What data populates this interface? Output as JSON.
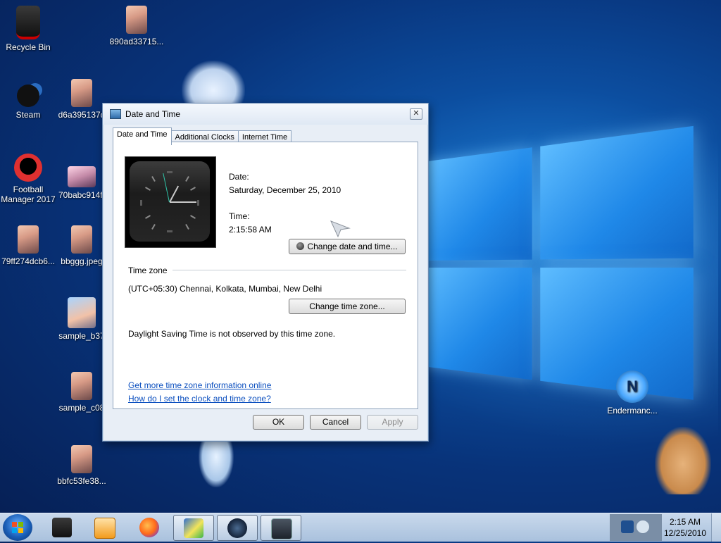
{
  "desktop_icons": [
    {
      "label": "Recycle Bin",
      "icon": "recycle-bin-icon"
    },
    {
      "label": "890ad33715...",
      "icon": "image-file-icon"
    },
    {
      "label": "Steam",
      "icon": "steam-icon"
    },
    {
      "label": "d6a395137d",
      "icon": "image-file-icon"
    },
    {
      "label": "Football Manager 2017",
      "icon": "football-manager-icon"
    },
    {
      "label": "70babc914f.",
      "icon": "image-file-icon"
    },
    {
      "label": "79ff274dcb6...",
      "icon": "image-file-icon"
    },
    {
      "label": "bbggg.jpeg",
      "icon": "image-file-icon"
    },
    {
      "label": "sample_b37",
      "icon": "image-file-icon"
    },
    {
      "label": "sample_c08",
      "icon": "image-file-icon"
    },
    {
      "label": "bbfc53fe38...",
      "icon": "image-file-icon"
    },
    {
      "label": "Endermanc...",
      "icon": "endermanch-icon"
    }
  ],
  "dialog": {
    "title": "Date and Time",
    "tabs": [
      "Date and Time",
      "Additional Clocks",
      "Internet Time"
    ],
    "active_tab": "Date and Time",
    "date_label": "Date:",
    "date_value": "Saturday, December 25, 2010",
    "time_label": "Time:",
    "time_value": "2:15:58 AM",
    "change_datetime_button": "Change date and time...",
    "timezone_header": "Time zone",
    "timezone_value": "(UTC+05:30) Chennai, Kolkata, Mumbai, New Delhi",
    "change_timezone_button": "Change time zone...",
    "dst_note": "Daylight Saving Time is not observed by this time zone.",
    "links": [
      "Get more time zone information online",
      "How do I set the clock and time zone?"
    ],
    "ok_button": "OK",
    "cancel_button": "Cancel",
    "apply_button": "Apply",
    "close_glyph": "✕"
  },
  "taskbar": {
    "pinned": [
      {
        "name": "unknown-app-icon",
        "active": false
      },
      {
        "name": "media-player-icon",
        "active": false
      },
      {
        "name": "firefox-icon",
        "active": false
      },
      {
        "name": "task-checkmark-icon",
        "active": true
      },
      {
        "name": "steam-icon",
        "active": true
      },
      {
        "name": "date-time-control-panel-icon",
        "active": true
      }
    ],
    "clock_time": "2:15 AM",
    "clock_date": "12/25/2010",
    "tray_arrow": "▲"
  },
  "colors": {
    "accent": "#0b4fbf",
    "wallpaper": "#08337a",
    "dialog_bg": "#e8eef6"
  }
}
